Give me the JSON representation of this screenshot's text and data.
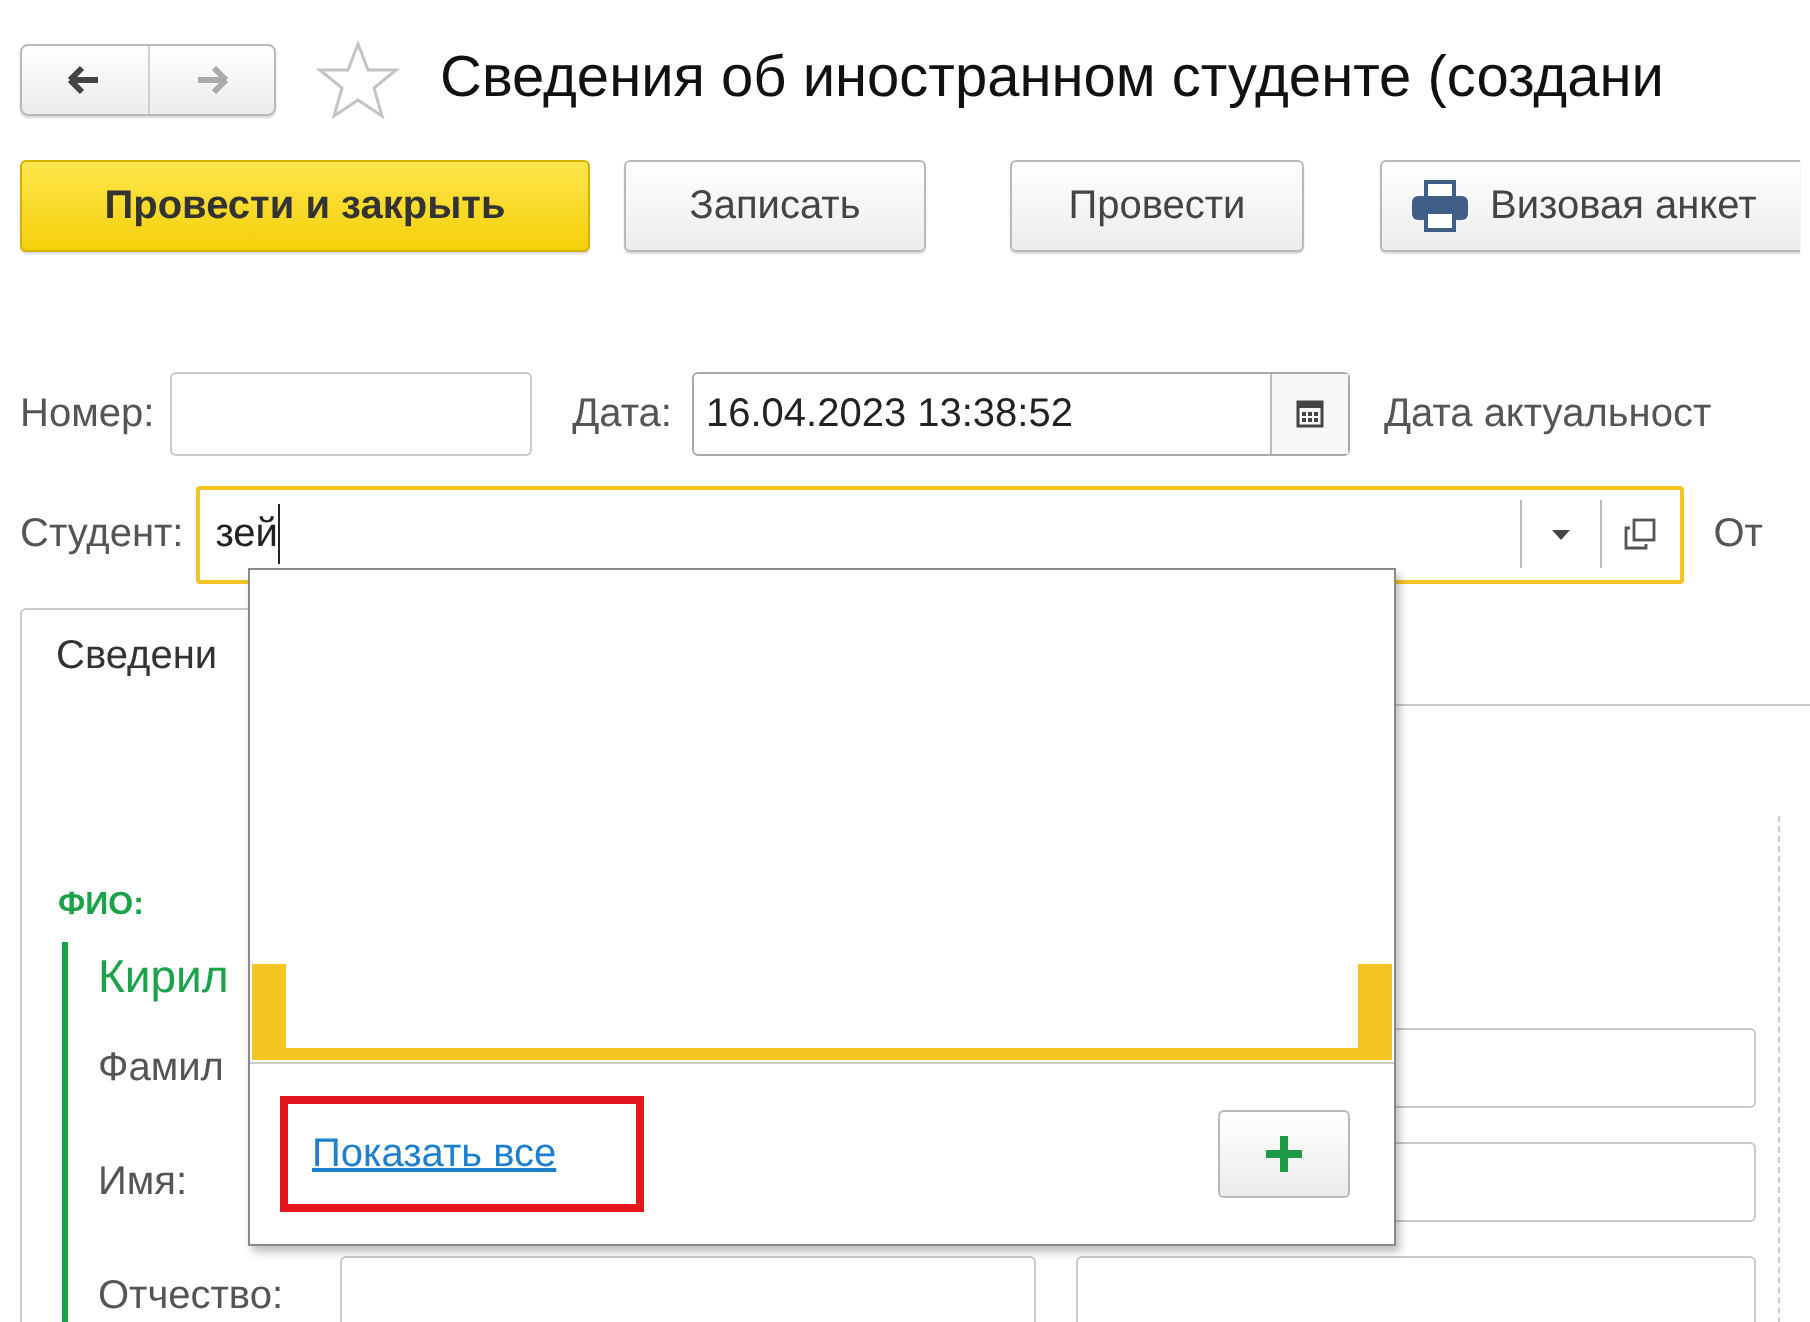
{
  "navigation": {
    "back": {
      "disabled": false
    },
    "forward": {
      "disabled": true
    }
  },
  "favorite": {
    "on": false
  },
  "title": "Сведения об иностранном студенте (создани",
  "toolbar": [
    {
      "label": "Провести и закрыть",
      "kind": "primary"
    },
    {
      "label": "Записать",
      "kind": "default"
    },
    {
      "label": "Провести",
      "kind": "default"
    },
    {
      "label": "Визовая анкет",
      "kind": "print"
    }
  ],
  "number": {
    "label": "Номер:"
  },
  "date": {
    "label": "Дата:",
    "value": "16.04.2023 13:38:52"
  },
  "actuality_date": {
    "label": "Дата актуальност"
  },
  "student": {
    "label": "Студент:",
    "value": "зей",
    "focused": true
  },
  "next_label": "От",
  "tabs": [
    {
      "label": "Сведени",
      "selected": true
    }
  ],
  "form": {
    "section_title": "ФИО:",
    "group_title": "Кирил",
    "rows": [
      {
        "label": "Фамил"
      },
      {
        "label": "Имя:"
      },
      {
        "label": "Отчество:"
      }
    ]
  },
  "dropdown": {
    "show_all": {
      "label": "Показать все",
      "highlighted": true
    }
  }
}
